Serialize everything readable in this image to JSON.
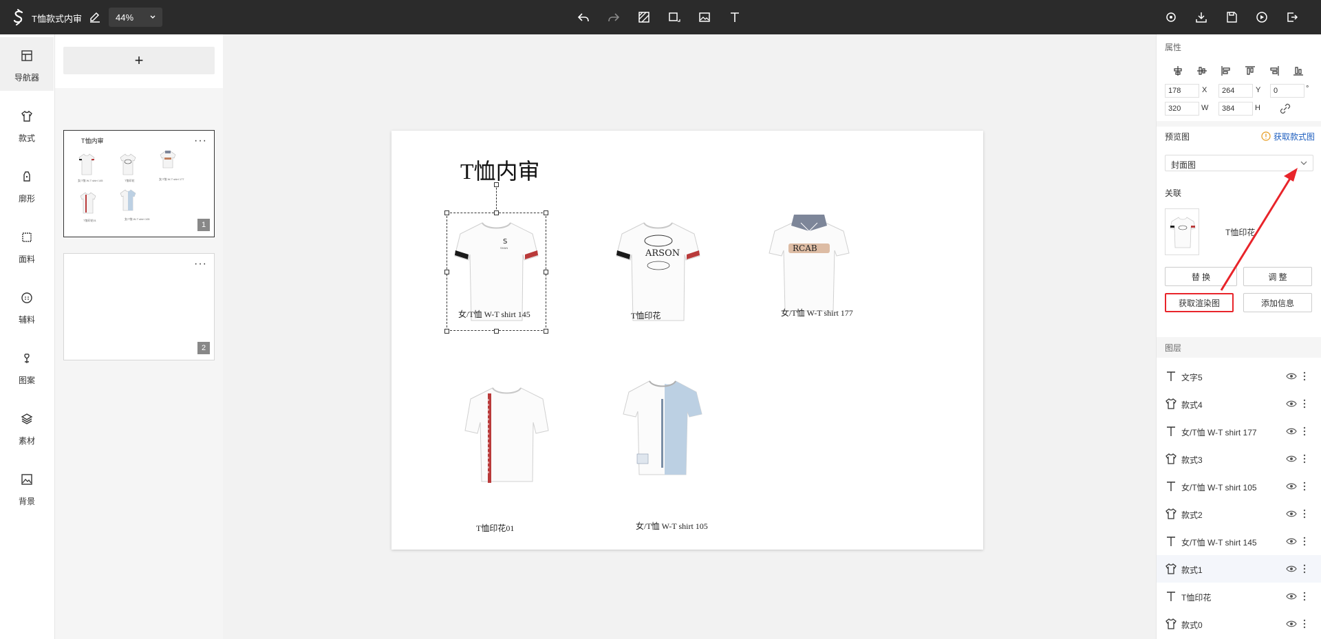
{
  "header": {
    "title": "T恤款式内审",
    "zoom": "44%"
  },
  "rail": {
    "items": [
      {
        "label": "导航器",
        "icon": "navigator-icon"
      },
      {
        "label": "款式",
        "icon": "tshirt-icon"
      },
      {
        "label": "廓形",
        "icon": "silhouette-icon"
      },
      {
        "label": "面料",
        "icon": "fabric-icon"
      },
      {
        "label": "辅料",
        "icon": "button-accessory-icon"
      },
      {
        "label": "图案",
        "icon": "pattern-icon"
      },
      {
        "label": "素材",
        "icon": "layers-material-icon"
      },
      {
        "label": "背景",
        "icon": "image-background-icon"
      }
    ]
  },
  "pages": {
    "add_label": "+",
    "cards": [
      {
        "number": "1",
        "thumb_title": "T恤内审",
        "more": "···"
      },
      {
        "number": "2",
        "thumb_title": "",
        "more": "···"
      }
    ],
    "thumb_captions": [
      "女/T恤 W-T shirt 145",
      "T恤印花",
      "女/T恤 W-T shirt 177",
      "T恤印花01",
      "女/T恤 W-T shirt 105"
    ]
  },
  "canvas": {
    "title": "T恤内审",
    "items": [
      {
        "caption": "女/T恤 W-T shirt 145"
      },
      {
        "caption": "T恤印花"
      },
      {
        "caption": "女/T恤 W-T shirt 177"
      },
      {
        "caption": "T恤印花01"
      },
      {
        "caption": "女/T恤 W-T shirt 105"
      }
    ]
  },
  "props": {
    "section_title": "属性",
    "x": "178",
    "x_label": "X",
    "y": "264",
    "y_label": "Y",
    "rotation": "0",
    "rotation_unit": "°",
    "w": "320",
    "w_label": "W",
    "h": "384",
    "h_label": "H",
    "preview_title": "预览图",
    "get_style_image": "获取款式图",
    "preview_select": "封面图",
    "link_title": "关联",
    "linked_item": "T恤印花",
    "replace_btn": "替 换",
    "adjust_btn": "调 整",
    "render_btn": "获取渲染图",
    "add_info_btn": "添加信息",
    "layers_title": "图层",
    "layers": [
      {
        "name": "文字5",
        "type": "text"
      },
      {
        "name": "款式4",
        "type": "style"
      },
      {
        "name": "女/T恤 W-T shirt 177",
        "type": "text"
      },
      {
        "name": "款式3",
        "type": "style"
      },
      {
        "name": "女/T恤 W-T shirt 105",
        "type": "text"
      },
      {
        "name": "款式2",
        "type": "style"
      },
      {
        "name": "女/T恤 W-T shirt 145",
        "type": "text"
      },
      {
        "name": "款式1",
        "type": "style",
        "selected": true
      },
      {
        "name": "T恤印花",
        "type": "text"
      },
      {
        "name": "款式0",
        "type": "style"
      }
    ]
  },
  "colors": {
    "topbar": "#2b2b2b",
    "highlight_red": "#e8242a",
    "link_blue": "#1f5fbf",
    "sleeve_red": "#b93a3a",
    "panel_blue": "#bcd0e3"
  }
}
